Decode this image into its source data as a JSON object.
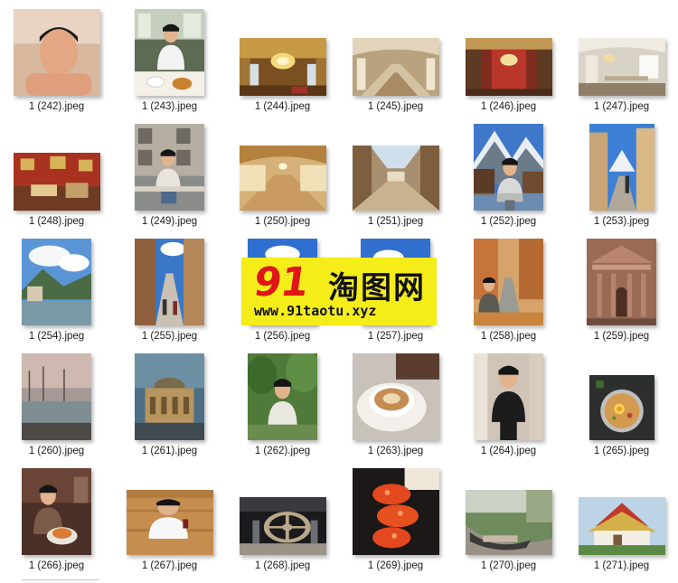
{
  "files": [
    {
      "name": "1 (242).jpeg",
      "scene": "portrait-shirtless-man"
    },
    {
      "name": "1 (243).jpeg",
      "scene": "man-dining-at-table"
    },
    {
      "name": "1 (244).jpeg",
      "scene": "gilded-palace-hall"
    },
    {
      "name": "1 (245).jpeg",
      "scene": "palace-staircase"
    },
    {
      "name": "1 (246).jpeg",
      "scene": "red-chandelier-room"
    },
    {
      "name": "1 (247).jpeg",
      "scene": "white-palace-gallery"
    },
    {
      "name": "1 (248).jpeg",
      "scene": "red-drawing-room"
    },
    {
      "name": "1 (249).jpeg",
      "scene": "man-sitting-on-railing"
    },
    {
      "name": "1 (250).jpeg",
      "scene": "hall-of-mirrors"
    },
    {
      "name": "1 (251).jpeg",
      "scene": "glass-roof-arcade"
    },
    {
      "name": "1 (252).jpeg",
      "scene": "man-alpine-village"
    },
    {
      "name": "1 (253).jpeg",
      "scene": "alpine-town-street"
    },
    {
      "name": "1 (254).jpeg",
      "scene": "lakeside-town"
    },
    {
      "name": "1 (255).jpeg",
      "scene": "shopping-street"
    },
    {
      "name": "1 (256).jpeg",
      "scene": "blue-sky-building"
    },
    {
      "name": "1 (257).jpeg",
      "scene": "blue-sky-building-2"
    },
    {
      "name": "1 (258).jpeg",
      "scene": "autumn-avenue"
    },
    {
      "name": "1 (259).jpeg",
      "scene": "classical-facade"
    },
    {
      "name": "1 (260).jpeg",
      "scene": "harbor-waterfront"
    },
    {
      "name": "1 (261).jpeg",
      "scene": "opera-house-dusk"
    },
    {
      "name": "1 (262).jpeg",
      "scene": "man-in-garden"
    },
    {
      "name": "1 (263).jpeg",
      "scene": "coffee-cup"
    },
    {
      "name": "1 (264).jpeg",
      "scene": "man-black-outfit"
    },
    {
      "name": "1 (265).jpeg",
      "scene": "noodle-bowl"
    },
    {
      "name": "1 (266).jpeg",
      "scene": "man-with-seafood"
    },
    {
      "name": "1 (267).jpeg",
      "scene": "man-white-tshirt"
    },
    {
      "name": "1 (268).jpeg",
      "scene": "museum-wheel-exhibit"
    },
    {
      "name": "1 (269).jpeg",
      "scene": "salmon-roe-sushi"
    },
    {
      "name": "1 (270).jpeg",
      "scene": "hammock-feet"
    },
    {
      "name": "1 (271).jpeg",
      "scene": "thai-temple"
    }
  ],
  "watermark": {
    "number": "91",
    "chinese": "淘图网",
    "url": "www.91taotu.xyz",
    "colors": {
      "background": "#f5ed1a",
      "number": "#e01515",
      "text": "#111111"
    }
  }
}
